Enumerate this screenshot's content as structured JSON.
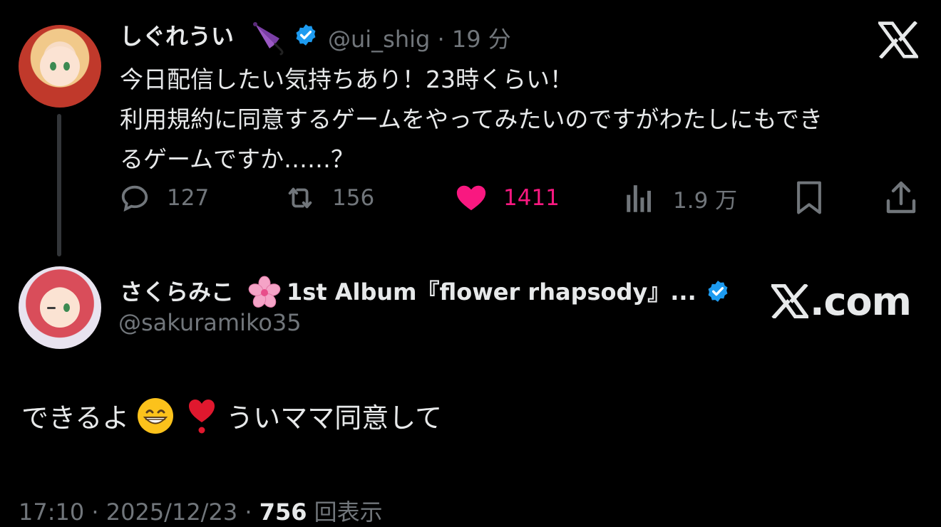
{
  "quoted_tweet": {
    "author_name": "しぐれうい",
    "author_emoji": "umbrella-emoji",
    "author_handle": "@ui_shig",
    "time_ago": "· 19 分",
    "body_lines": [
      "今日配信したい気持ちあり！23時くらい！",
      "利用規約に同意するゲームをやってみたいのですがわたしにもでき",
      "るゲームですか……？"
    ],
    "actions": {
      "reply_count": "127",
      "retweet_count": "156",
      "like_count": "1411",
      "view_count": "1.9 万"
    }
  },
  "reply_tweet": {
    "author_name": "さくらみこ",
    "author_emoji": "cherry-blossom-emoji",
    "author_name_suffix": "1st Album『flower rhapsody』...",
    "author_handle": "@sakuramiko35",
    "site_label": ".com",
    "text_before": "できるよ",
    "text_after": "ういママ同意して",
    "timestamp": "17:10 · 2025/12/23 ·",
    "views_number": "756",
    "views_label": "回表示"
  },
  "colors": {
    "background": "#000000",
    "primary_text": "#e7e9ea",
    "secondary_text": "#71767b",
    "like_pink": "#f91880",
    "verified_blue": "#1d9bf0",
    "thread_line": "#333639"
  }
}
